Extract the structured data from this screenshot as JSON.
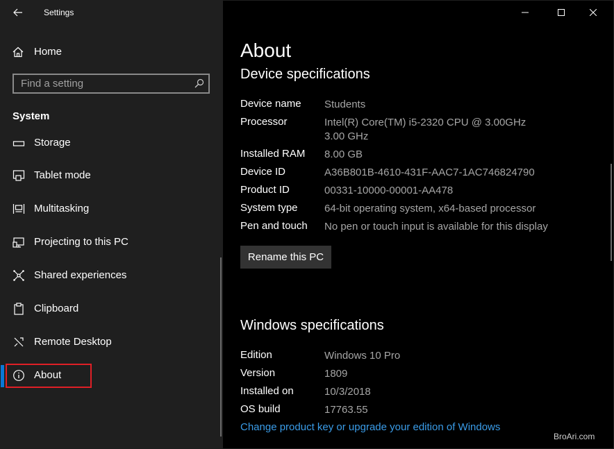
{
  "window": {
    "title": "Settings"
  },
  "sidebar": {
    "home_label": "Home",
    "search_placeholder": "Find a setting",
    "section_title": "System",
    "items": [
      {
        "label": "Storage",
        "icon": "storage-icon"
      },
      {
        "label": "Tablet mode",
        "icon": "tablet-mode-icon"
      },
      {
        "label": "Multitasking",
        "icon": "multitasking-icon"
      },
      {
        "label": "Projecting to this PC",
        "icon": "projecting-icon"
      },
      {
        "label": "Shared experiences",
        "icon": "shared-experiences-icon"
      },
      {
        "label": "Clipboard",
        "icon": "clipboard-icon"
      },
      {
        "label": "Remote Desktop",
        "icon": "remote-desktop-icon"
      },
      {
        "label": "About",
        "icon": "info-icon",
        "selected": true
      }
    ],
    "accent_color": "#0a78d7",
    "highlight_color": "#e01f26"
  },
  "main": {
    "page_title": "About",
    "device_specs": {
      "heading": "Device specifications",
      "rows": [
        {
          "key": "Device name",
          "value": "Students"
        },
        {
          "key": "Processor",
          "value": "Intel(R) Core(TM) i5-2320 CPU @ 3.00GHz   3.00 GHz"
        },
        {
          "key": "Installed RAM",
          "value": "8.00 GB"
        },
        {
          "key": "Device ID",
          "value": "A36B801B-4610-431F-AAC7-1AC746824790"
        },
        {
          "key": "Product ID",
          "value": "00331-10000-00001-AA478"
        },
        {
          "key": "System type",
          "value": "64-bit operating system, x64-based processor"
        },
        {
          "key": "Pen and touch",
          "value": "No pen or touch input is available for this display"
        }
      ],
      "rename_button": "Rename this PC"
    },
    "windows_specs": {
      "heading": "Windows specifications",
      "rows": [
        {
          "key": "Edition",
          "value": "Windows 10 Pro"
        },
        {
          "key": "Version",
          "value": "1809"
        },
        {
          "key": "Installed on",
          "value": "10/3/2018"
        },
        {
          "key": "OS build",
          "value": "17763.55"
        }
      ],
      "link": "Change product key or upgrade your edition of Windows"
    },
    "link_color": "#3a9ce8"
  },
  "watermark": "BroAri.com"
}
